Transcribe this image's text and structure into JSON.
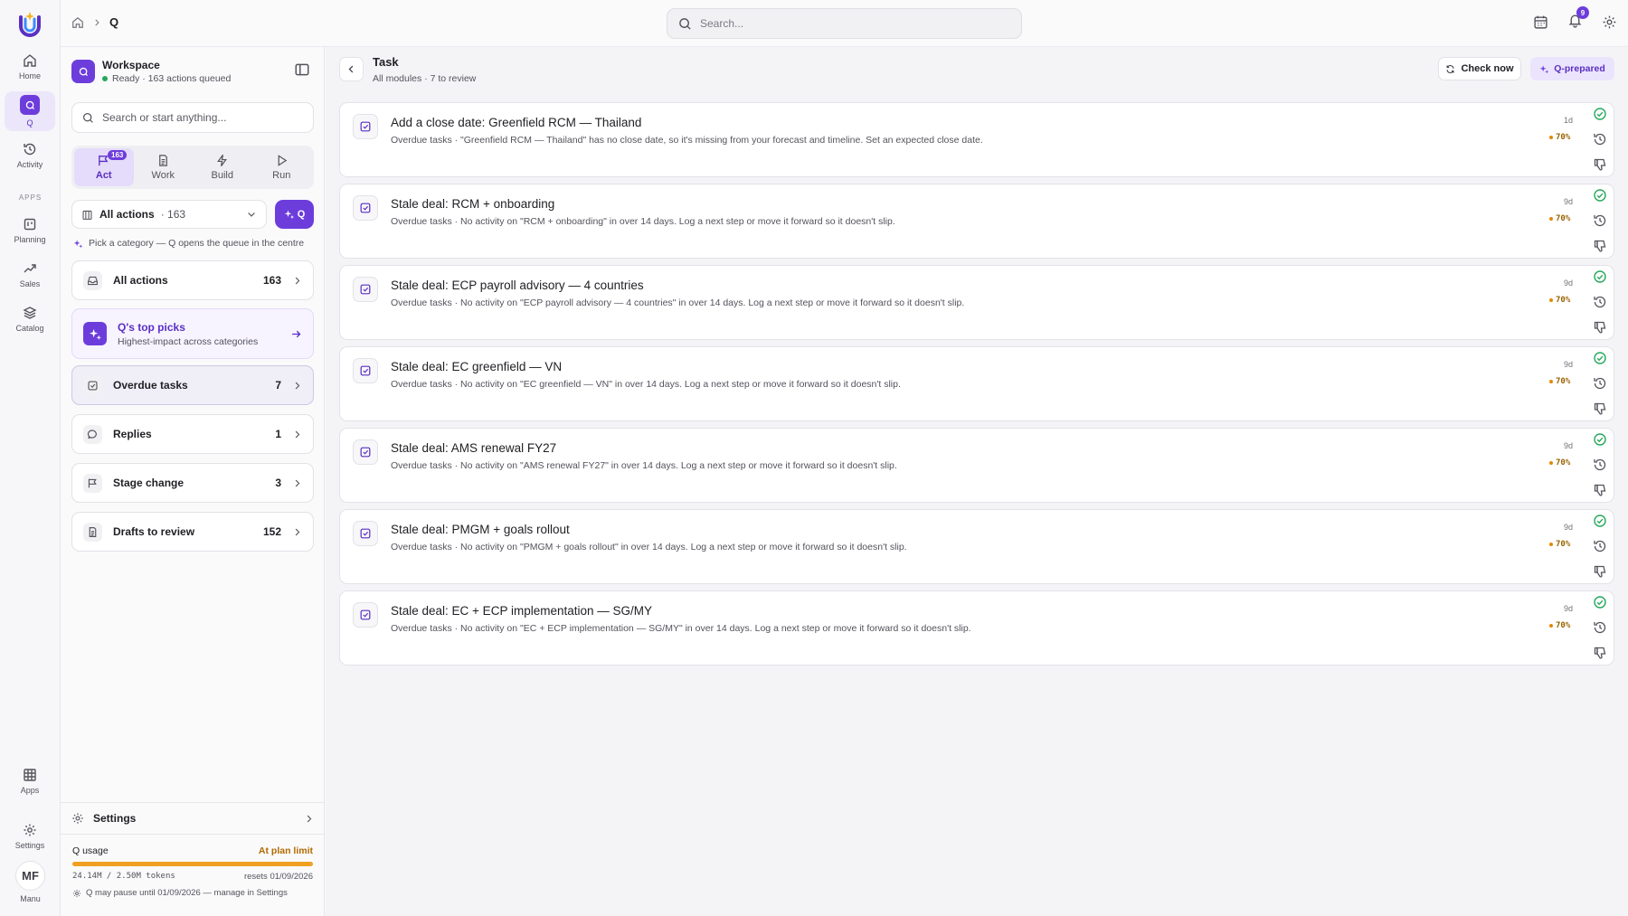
{
  "rail": {
    "items": [
      {
        "label": "Home"
      },
      {
        "label": "Q"
      },
      {
        "label": "Activity"
      },
      {
        "label": "Planning"
      },
      {
        "label": "Sales"
      },
      {
        "label": "Catalog"
      },
      {
        "label": "Apps"
      },
      {
        "label": "Settings"
      }
    ],
    "section_apps": "APPS",
    "avatar_initials": "MF",
    "avatar_label": "Manu"
  },
  "topbar": {
    "breadcrumb_current": "Q",
    "search_placeholder": "Search...",
    "notification_count": "9"
  },
  "panel": {
    "workspace_name": "Workspace",
    "workspace_status": "Ready · 163 actions queued",
    "search_placeholder": "Search or start anything...",
    "modes": [
      {
        "label": "Act",
        "count": "163"
      },
      {
        "label": "Work"
      },
      {
        "label": "Build"
      },
      {
        "label": "Run"
      }
    ],
    "filter_label": "All actions",
    "filter_count": "· 163",
    "q_button": "Q",
    "hint": "Pick a category — Q opens the queue in the centre",
    "categories": [
      {
        "label": "All actions",
        "count": "163"
      },
      {
        "label": "Q's top picks",
        "sub": "Highest-impact across categories"
      },
      {
        "label": "Overdue tasks",
        "count": "7"
      },
      {
        "label": "Replies",
        "count": "1"
      },
      {
        "label": "Stage change",
        "count": "3"
      },
      {
        "label": "Drafts to review",
        "count": "152"
      }
    ],
    "settings_label": "Settings",
    "usage": {
      "label": "Q usage",
      "status": "At plan limit",
      "tokens": "24.14M / 2.50M tokens",
      "resets": "resets 01/09/2026",
      "note": "Q may pause until 01/09/2026 — manage in Settings",
      "fill": 1.0
    }
  },
  "main": {
    "title": "Task",
    "subtitle": "All modules · 7 to review",
    "check_now": "Check now",
    "q_prepared": "Q-prepared",
    "tasks": [
      {
        "title": "Add a close date: Greenfield RCM — Thailand",
        "desc": "Overdue tasks · \"Greenfield RCM — Thailand\" has no close date, so it's missing from your forecast and timeline. Set an expected close date.",
        "age": "1d",
        "confidence": "70%"
      },
      {
        "title": "Stale deal: RCM + onboarding",
        "desc": "Overdue tasks · No activity on \"RCM + onboarding\" in over 14 days. Log a next step or move it forward so it doesn't slip.",
        "age": "9d",
        "confidence": "70%"
      },
      {
        "title": "Stale deal: ECP payroll advisory — 4 countries",
        "desc": "Overdue tasks · No activity on \"ECP payroll advisory — 4 countries\" in over 14 days. Log a next step or move it forward so it doesn't slip.",
        "age": "9d",
        "confidence": "70%"
      },
      {
        "title": "Stale deal: EC greenfield — VN",
        "desc": "Overdue tasks · No activity on \"EC greenfield — VN\" in over 14 days. Log a next step or move it forward so it doesn't slip.",
        "age": "9d",
        "confidence": "70%"
      },
      {
        "title": "Stale deal: AMS renewal FY27",
        "desc": "Overdue tasks · No activity on \"AMS renewal FY27\" in over 14 days. Log a next step or move it forward so it doesn't slip.",
        "age": "9d",
        "confidence": "70%"
      },
      {
        "title": "Stale deal: PMGM + goals rollout",
        "desc": "Overdue tasks · No activity on \"PMGM + goals rollout\" in over 14 days. Log a next step or move it forward so it doesn't slip.",
        "age": "9d",
        "confidence": "70%"
      },
      {
        "title": "Stale deal: EC + ECP implementation — SG/MY",
        "desc": "Overdue tasks · No activity on \"EC + ECP implementation — SG/MY\" in over 14 days. Log a next step or move it forward so it doesn't slip.",
        "age": "9d",
        "confidence": "70%"
      }
    ]
  },
  "colors": {
    "accent": "#6d3ddc",
    "success": "#24a85a",
    "warning": "#e08a00"
  }
}
